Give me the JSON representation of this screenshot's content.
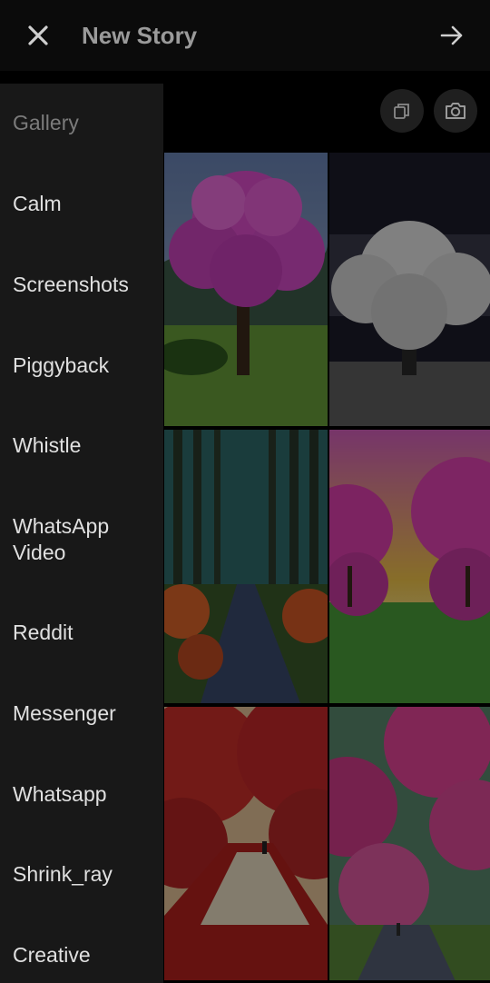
{
  "header": {
    "title": "New Story",
    "close_icon": "close-icon",
    "next_icon": "arrow-right-icon"
  },
  "toolbar": {
    "multi_select_icon": "multi-select-icon",
    "camera_icon": "camera-icon"
  },
  "drawer": {
    "header": "Gallery",
    "items": [
      {
        "label": "Calm"
      },
      {
        "label": "Screenshots"
      },
      {
        "label": "Piggyback"
      },
      {
        "label": "Whistle"
      },
      {
        "label": "WhatsApp Video"
      },
      {
        "label": "Reddit"
      },
      {
        "label": "Messenger"
      },
      {
        "label": "Whatsapp"
      },
      {
        "label": "Shrink_ray"
      },
      {
        "label": "Creative"
      }
    ]
  },
  "gallery": {
    "thumbnails": [
      {
        "subject": "pink tree on hill"
      },
      {
        "subject": "white tree in field"
      },
      {
        "subject": "autumn forest road"
      },
      {
        "subject": "pink blossom avenue sunset"
      },
      {
        "subject": "red autumn path with walker"
      },
      {
        "subject": "pink blossom forest path"
      }
    ]
  },
  "colors": {
    "background": "#000000",
    "drawer": "#181818",
    "topbar": "#0b0b0b"
  }
}
